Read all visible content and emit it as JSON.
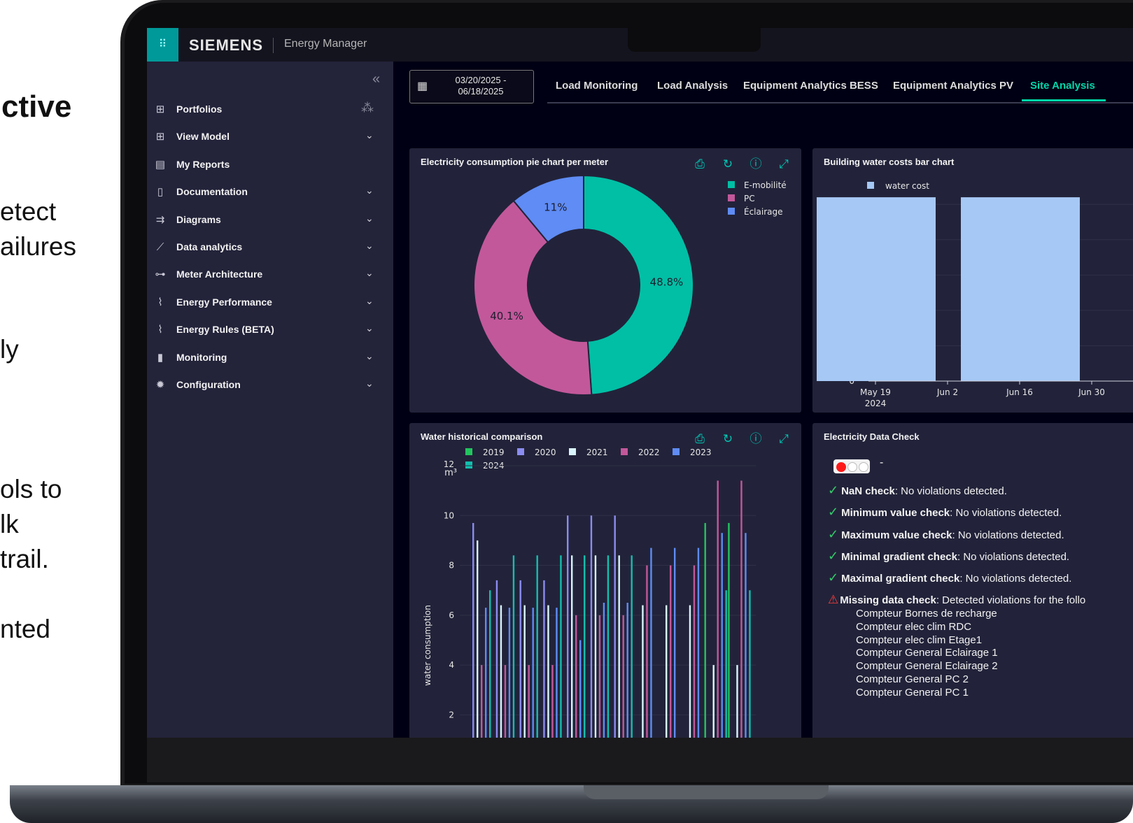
{
  "left_text": [
    "ctive",
    "etect",
    "ailures",
    "ly",
    "ols to",
    "lk",
    "trail.",
    "nted"
  ],
  "header": {
    "brand": "SIEMENS",
    "app_name": "Energy Manager"
  },
  "sidebar": {
    "items": [
      {
        "label": "Portfolios",
        "icon": "hierarchy-icon",
        "chevron": false,
        "spinner": true
      },
      {
        "label": "View Model",
        "icon": "hierarchy-icon",
        "chevron": true
      },
      {
        "label": "My Reports",
        "icon": "report-icon",
        "chevron": false
      },
      {
        "label": "Documentation",
        "icon": "document-icon",
        "chevron": true
      },
      {
        "label": "Diagrams",
        "icon": "diagram-icon",
        "chevron": true
      },
      {
        "label": "Data analytics",
        "icon": "analytics-icon",
        "chevron": true
      },
      {
        "label": "Meter Architecture",
        "icon": "meter-architecture-icon",
        "chevron": true
      },
      {
        "label": "Energy Performance",
        "icon": "trend-icon",
        "chevron": true
      },
      {
        "label": "Energy Rules (BETA)",
        "icon": "trend-icon",
        "chevron": true
      },
      {
        "label": "Monitoring",
        "icon": "bar-chart-icon",
        "chevron": true
      },
      {
        "label": "Configuration",
        "icon": "gear-icon",
        "chevron": true
      }
    ]
  },
  "date_range": {
    "line1": "03/20/2025 -",
    "line2": "06/18/2025"
  },
  "tabs": [
    {
      "label": "Load Monitoring",
      "active": false
    },
    {
      "label": "Load Analysis",
      "active": false
    },
    {
      "label": "Equipment Analytics BESS",
      "active": false
    },
    {
      "label": "Equipment Analytics PV",
      "active": false
    },
    {
      "label": "Site Analysis",
      "active": true
    }
  ],
  "colors": {
    "accent": "#00d7a9",
    "emobilite": "#00bfa5",
    "pc": "#c2589a",
    "eclairage": "#5f8cf5",
    "water_cost": "#a6c8f5",
    "y2019": "#22c55e",
    "y2020": "#8b8cf0",
    "y2021": "#d9f5fb",
    "y2022": "#c2589a",
    "y2023": "#5f8cf5",
    "y2024": "#12bfae"
  },
  "cards": {
    "pie": {
      "title": "Electricity consumption pie chart per meter"
    },
    "water_cost": {
      "title": "Building water costs bar chart"
    },
    "water_hist": {
      "title": "Water historical comparison"
    },
    "data_check": {
      "title": "Electricity Data Check"
    }
  },
  "chart_data": [
    {
      "type": "pie",
      "hole": true,
      "labels": [
        "E-mobilité",
        "PC",
        "Éclairage"
      ],
      "values": [
        48.8,
        40.1,
        11
      ],
      "value_labels": [
        "48.8%",
        "40.1%",
        "11%"
      ],
      "legend": "top-right"
    },
    {
      "type": "bar",
      "series": [
        {
          "name": "water cost",
          "x": [
            "2024-05-19",
            "2024-06-16"
          ],
          "values": [
            26,
            26
          ]
        }
      ],
      "x_tick_labels": [
        "May 19",
        "Jun 2",
        "Jun 16",
        "Jun 30"
      ],
      "x_tick_sublabel": "2024",
      "ylabel": "€",
      "y_ticks": [
        0,
        5,
        10,
        15,
        20,
        25
      ],
      "ylim": [
        0,
        27
      ]
    },
    {
      "type": "bar",
      "ylabel": "water consumption",
      "y_unit": "m³",
      "y_ticks": [
        2,
        4,
        6,
        8,
        10,
        12
      ],
      "ylim": [
        1,
        12
      ],
      "groups": 12,
      "series": [
        {
          "name": "2019",
          "values": [
            0,
            0,
            0,
            0,
            0,
            0,
            0,
            0,
            0,
            0,
            9.7,
            9.7
          ]
        },
        {
          "name": "2020",
          "values": [
            9.7,
            7.4,
            7.4,
            7.4,
            10,
            10,
            10,
            0,
            0,
            0,
            0,
            0
          ]
        },
        {
          "name": "2021",
          "values": [
            9,
            6.4,
            6.4,
            6.4,
            8.4,
            8.4,
            8.4,
            6.4,
            6.4,
            6.4,
            4,
            4
          ]
        },
        {
          "name": "2022",
          "values": [
            4,
            4,
            4,
            4,
            6,
            6,
            6,
            8,
            8,
            8,
            11.4,
            11.4
          ]
        },
        {
          "name": "2023",
          "values": [
            6.3,
            6.3,
            6.3,
            6.3,
            5,
            6.5,
            6.5,
            8.7,
            8.7,
            8.7,
            9.3,
            9.3
          ]
        },
        {
          "name": "2024",
          "values": [
            7,
            8.4,
            8.4,
            8.4,
            8.4,
            8.4,
            8.4,
            0,
            0,
            0,
            7,
            7
          ]
        }
      ]
    }
  ],
  "data_check": {
    "status": "-",
    "checks": [
      {
        "name": "NaN check",
        "result": ": No violations detected.",
        "ok": true
      },
      {
        "name": "Minimum value check",
        "result": ": No violations detected.",
        "ok": true
      },
      {
        "name": "Maximum value check",
        "result": ": No violations detected.",
        "ok": true
      },
      {
        "name": "Minimal gradient check",
        "result": ": No violations detected.",
        "ok": true
      },
      {
        "name": "Maximal gradient check",
        "result": ": No violations detected.",
        "ok": true
      },
      {
        "name": "Missing data check",
        "result": ": Detected violations for the follo",
        "ok": false
      }
    ],
    "meters": [
      "Compteur Bornes de recharge",
      "Compteur elec clim RDC",
      "Compteur elec clim Etage1",
      "Compteur General Eclairage 1",
      "Compteur General Eclairage 2",
      "Compteur General PC 2",
      "Compteur General PC 1"
    ]
  }
}
